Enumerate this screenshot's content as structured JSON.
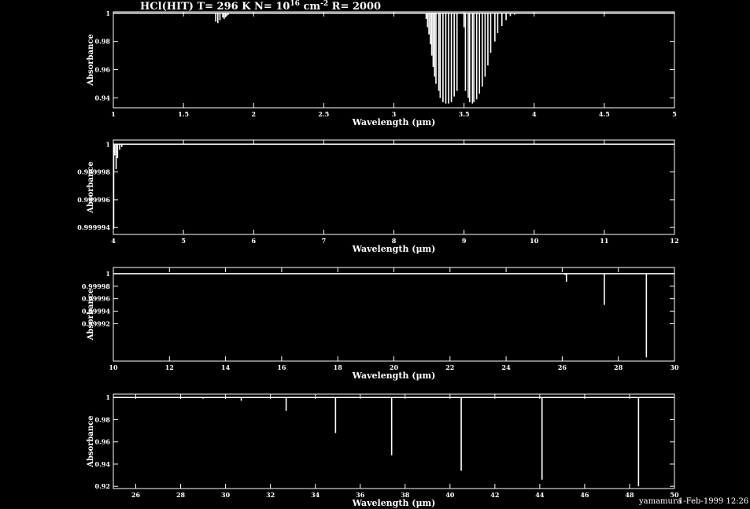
{
  "title": {
    "prefix": "HCl(HIT) T= 296 K N= 10",
    "exponent1": "16",
    "middle": " cm",
    "exponent2": "-2",
    "suffix": " R= 2000"
  },
  "footer": {
    "user": "yamamura",
    "date": "1-Feb-1999 12:26"
  },
  "colors": {
    "background": "#000000",
    "foreground": "#ffffff"
  },
  "chart_data": [
    {
      "type": "line",
      "xlabel": "Wavelength (μm)",
      "ylabel": "Absorbance",
      "xlim": [
        1,
        5
      ],
      "ylim": [
        0.933,
        1.001
      ],
      "xticks": [
        1,
        1.5,
        2,
        2.5,
        3,
        3.5,
        4,
        4.5,
        5
      ],
      "xtick_labels": [
        "1",
        "1.5",
        "2",
        "2.5",
        "3",
        "3.5",
        "4",
        "4.5",
        "5"
      ],
      "yticks": [
        0.94,
        0.96,
        0.98,
        1
      ],
      "ytick_labels": [
        "0.94",
        "0.96",
        "0.98",
        "1"
      ],
      "lines": [
        {
          "x": 1.73,
          "y": 0.994
        },
        {
          "x": 1.745,
          "y": 0.993
        },
        {
          "x": 1.76,
          "y": 0.995
        },
        {
          "x": 1.78,
          "y": 0.997
        },
        {
          "x": 1.79,
          "y": 0.996
        },
        {
          "x": 1.8,
          "y": 0.997
        },
        {
          "x": 1.81,
          "y": 0.998
        },
        {
          "x": 1.82,
          "y": 0.999
        },
        {
          "x": 3.23,
          "y": 0.996
        },
        {
          "x": 3.24,
          "y": 0.99
        },
        {
          "x": 3.25,
          "y": 0.985
        },
        {
          "x": 3.26,
          "y": 0.978
        },
        {
          "x": 3.27,
          "y": 0.97
        },
        {
          "x": 3.28,
          "y": 0.962
        },
        {
          "x": 3.29,
          "y": 0.955
        },
        {
          "x": 3.3,
          "y": 0.95
        },
        {
          "x": 3.32,
          "y": 0.945
        },
        {
          "x": 3.33,
          "y": 0.94
        },
        {
          "x": 3.35,
          "y": 0.937
        },
        {
          "x": 3.37,
          "y": 0.936
        },
        {
          "x": 3.39,
          "y": 0.936
        },
        {
          "x": 3.41,
          "y": 0.937
        },
        {
          "x": 3.43,
          "y": 0.941
        },
        {
          "x": 3.45,
          "y": 0.945
        },
        {
          "x": 3.5,
          "y": 0.99
        },
        {
          "x": 3.51,
          "y": 0.945
        },
        {
          "x": 3.53,
          "y": 0.94
        },
        {
          "x": 3.54,
          "y": 0.937
        },
        {
          "x": 3.56,
          "y": 0.936
        },
        {
          "x": 3.57,
          "y": 0.937
        },
        {
          "x": 3.59,
          "y": 0.939
        },
        {
          "x": 3.61,
          "y": 0.943
        },
        {
          "x": 3.63,
          "y": 0.948
        },
        {
          "x": 3.65,
          "y": 0.955
        },
        {
          "x": 3.67,
          "y": 0.963
        },
        {
          "x": 3.69,
          "y": 0.972
        },
        {
          "x": 3.72,
          "y": 0.98
        },
        {
          "x": 3.74,
          "y": 0.986
        },
        {
          "x": 3.77,
          "y": 0.991
        },
        {
          "x": 3.8,
          "y": 0.995
        },
        {
          "x": 3.83,
          "y": 0.998
        },
        {
          "x": 3.86,
          "y": 0.999
        }
      ]
    },
    {
      "type": "line",
      "xlabel": "Wavelength (μm)",
      "ylabel": "Absorbance",
      "xlim": [
        4,
        12
      ],
      "ylim": [
        0.9999935,
        1.0000003
      ],
      "xticks": [
        4,
        5,
        6,
        7,
        8,
        9,
        10,
        11,
        12
      ],
      "xtick_labels": [
        "4",
        "5",
        "6",
        "7",
        "8",
        "9",
        "10",
        "11",
        "12"
      ],
      "yticks": [
        0.999994,
        0.999996,
        0.999998,
        1
      ],
      "ytick_labels": [
        "0.999994",
        "0.999996",
        "0.999998",
        "1"
      ],
      "lines": [
        {
          "x": 4.005,
          "y": 0.9999939
        },
        {
          "x": 4.02,
          "y": 0.9999992
        },
        {
          "x": 4.04,
          "y": 0.9999982
        },
        {
          "x": 4.06,
          "y": 0.999999
        },
        {
          "x": 4.09,
          "y": 0.9999996
        },
        {
          "x": 4.12,
          "y": 0.9999998
        }
      ]
    },
    {
      "type": "line",
      "xlabel": "Wavelength (μm)",
      "ylabel": "Absorbance",
      "xlim": [
        10,
        30
      ],
      "ylim": [
        0.99986,
        1.00001
      ],
      "xticks": [
        10,
        12,
        14,
        16,
        18,
        20,
        22,
        24,
        26,
        28,
        30
      ],
      "xtick_labels": [
        "10",
        "12",
        "14",
        "16",
        "18",
        "20",
        "22",
        "24",
        "26",
        "28",
        "30"
      ],
      "yticks": [
        0.99992,
        0.99994,
        0.99996,
        0.99998,
        1
      ],
      "ytick_labels": [
        "0.99992",
        "0.99994",
        "0.99996",
        "0.99998",
        "1"
      ],
      "lines": [
        {
          "x": 26.1,
          "y": 0.999998
        },
        {
          "x": 26.15,
          "y": 0.999987
        },
        {
          "x": 27.5,
          "y": 0.99995
        },
        {
          "x": 29.0,
          "y": 0.999866
        }
      ]
    },
    {
      "type": "line",
      "xlabel": "Wavelength (μm)",
      "ylabel": "Absorbance",
      "xlim": [
        25,
        50
      ],
      "ylim": [
        0.918,
        1.003
      ],
      "xticks": [
        26,
        28,
        30,
        32,
        34,
        36,
        38,
        40,
        42,
        44,
        46,
        48,
        50
      ],
      "xtick_labels": [
        "26",
        "28",
        "30",
        "32",
        "34",
        "36",
        "38",
        "40",
        "42",
        "44",
        "46",
        "48",
        "50"
      ],
      "yticks": [
        0.92,
        0.94,
        0.96,
        0.98,
        1
      ],
      "ytick_labels": [
        "0.92",
        "0.94",
        "0.96",
        "0.98",
        "1"
      ],
      "lines": [
        {
          "x": 29.0,
          "y": 0.999
        },
        {
          "x": 30.7,
          "y": 0.997
        },
        {
          "x": 32.7,
          "y": 0.988
        },
        {
          "x": 34.9,
          "y": 0.968
        },
        {
          "x": 37.4,
          "y": 0.948
        },
        {
          "x": 40.5,
          "y": 0.934
        },
        {
          "x": 44.1,
          "y": 0.926
        },
        {
          "x": 48.4,
          "y": 0.92
        }
      ]
    }
  ]
}
